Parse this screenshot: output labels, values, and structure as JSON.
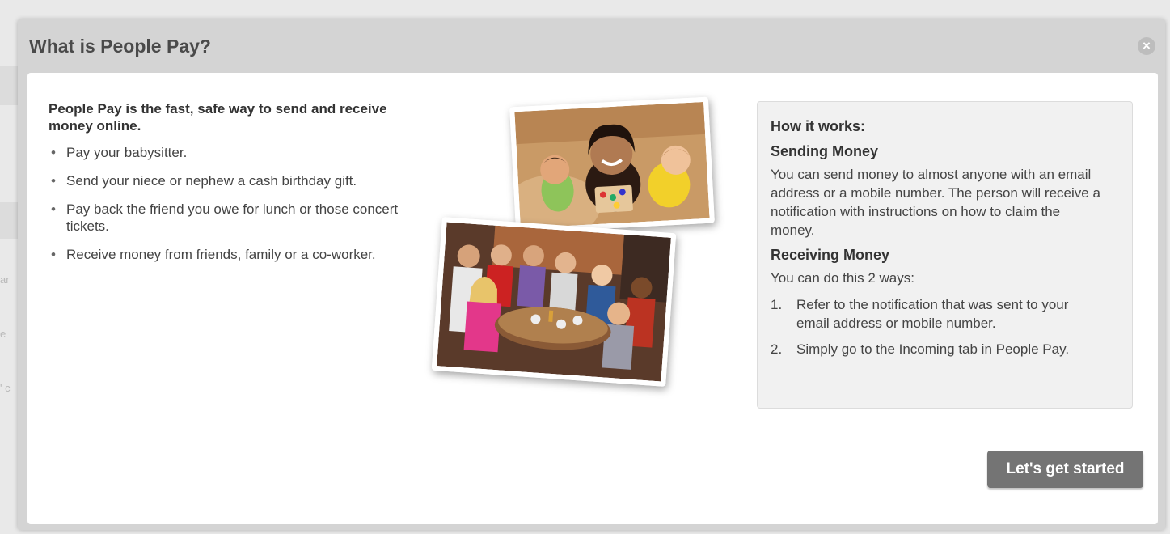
{
  "background": {
    "fragments": [
      "ar",
      "e",
      "' c"
    ]
  },
  "modal": {
    "title": "What is People Pay?",
    "close_glyph": "×"
  },
  "intro": {
    "heading": "People Pay is the fast, safe way to send and receive money online.",
    "bullets": [
      "Pay your babysitter.",
      "Send your niece or nephew a cash birthday gift.",
      "Pay back the friend you owe for lunch or those concert tickets.",
      "Receive money from friends, family or a co-worker."
    ]
  },
  "images": {
    "kids_photo": "kids-photo",
    "group_photo": "group-dinner-photo"
  },
  "how_it_works": {
    "title": "How it works:",
    "sending_title": "Sending Money",
    "sending_text": "You can send money to almost anyone with an email address or a mobile number. The person will receive a notification with instructions on how to claim the money.",
    "receiving_title": "Receiving Money",
    "receiving_intro": "You can do this 2 ways:",
    "steps": [
      {
        "number": "1.",
        "text": "Refer to the notification that was sent to your email address or mobile number."
      },
      {
        "number": "2.",
        "text": "Simply go to the Incoming tab in People Pay."
      }
    ]
  },
  "footer": {
    "start_button": "Let's get started"
  },
  "colors": {
    "overlay": "#d4d4d4",
    "panel_bg": "#f1f1f1",
    "button_bg": "#747474"
  }
}
